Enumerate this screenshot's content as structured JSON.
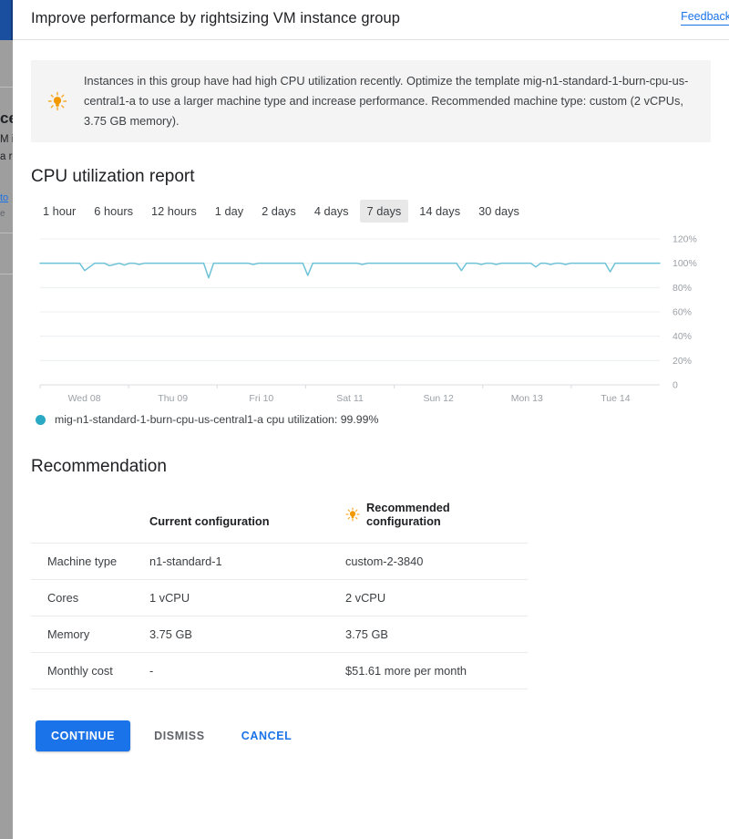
{
  "background": {
    "title_fragment": "ce",
    "line1_fragment": "M i",
    "line2_fragment": "a r",
    "link_fragment": "to",
    "line3_fragment": "e"
  },
  "dialog": {
    "title": "Improve performance by rightsizing VM instance group",
    "feedback_label": "Feedback"
  },
  "banner": {
    "icon": "lightbulb-icon",
    "text": "Instances in this group have had high CPU utilization recently. Optimize the template mig-n1-standard-1-burn-cpu-us-central1-a to use a larger machine type and increase performance. Recommended machine type: custom (2 vCPUs, 3.75 GB memory)."
  },
  "cpu_section": {
    "heading": "CPU utilization report",
    "ranges": [
      {
        "label": "1 hour",
        "selected": false
      },
      {
        "label": "6 hours",
        "selected": false
      },
      {
        "label": "12 hours",
        "selected": false
      },
      {
        "label": "1 day",
        "selected": false
      },
      {
        "label": "2 days",
        "selected": false
      },
      {
        "label": "4 days",
        "selected": false
      },
      {
        "label": "7 days",
        "selected": true
      },
      {
        "label": "14 days",
        "selected": false
      },
      {
        "label": "30 days",
        "selected": false
      }
    ],
    "legend": {
      "color": "#2aa8c4",
      "label": "mig-n1-standard-1-burn-cpu-us-central1-a cpu utilization: 99.99%"
    }
  },
  "chart_data": {
    "type": "line",
    "title": "CPU utilization report",
    "xlabel": "",
    "ylabel": "",
    "ylim": [
      0,
      120
    ],
    "yticks": [
      0,
      20,
      40,
      60,
      80,
      100,
      120
    ],
    "ytick_labels": [
      "0",
      "20%",
      "40%",
      "60%",
      "80%",
      "100%",
      "120%"
    ],
    "grid": true,
    "legend_position": "below",
    "categories": [
      "Wed 08",
      "Thu 09",
      "Fri 10",
      "Sat 11",
      "Sun 12",
      "Mon 13",
      "Tue 14"
    ],
    "line_color": "#6dc2d6",
    "series": [
      {
        "name": "mig-n1-standard-1-burn-cpu-us-central1-a cpu utilization",
        "current_value": 99.99,
        "values": [
          100,
          100,
          100,
          100,
          100,
          100,
          100,
          100,
          99.9,
          94,
          97,
          100,
          100,
          100,
          98,
          99,
          100,
          98.5,
          100,
          100,
          99,
          100,
          100,
          100,
          100,
          100,
          100,
          100,
          100,
          100,
          100,
          100,
          100,
          100,
          88,
          100,
          100,
          100,
          100,
          100,
          100,
          100,
          100,
          99,
          100,
          100,
          100,
          100,
          100,
          100,
          100,
          100,
          100,
          100,
          90,
          100,
          100,
          100,
          100,
          100,
          100,
          100,
          100,
          100,
          100,
          99,
          100,
          100,
          100,
          100,
          100,
          100,
          100,
          100,
          100,
          100,
          100,
          100,
          100,
          100,
          100,
          100,
          100,
          100,
          100,
          94,
          100,
          100,
          100,
          99,
          100,
          100,
          99,
          100,
          100,
          100,
          100,
          100,
          100,
          100,
          97,
          100,
          100,
          99,
          100,
          100,
          99,
          100,
          100,
          100,
          100,
          100,
          100,
          100,
          100,
          93,
          100,
          100,
          100,
          100,
          100,
          100,
          100,
          100,
          100,
          100
        ]
      }
    ]
  },
  "recommendation": {
    "heading": "Recommendation",
    "columns": [
      "",
      "Current configuration",
      "Recommended configuration"
    ],
    "recommended_icon": "lightbulb-icon",
    "rows": [
      {
        "label": "Machine type",
        "current": "n1-standard-1",
        "recommended": "custom-2-3840"
      },
      {
        "label": "Cores",
        "current": "1 vCPU",
        "recommended": "2 vCPU"
      },
      {
        "label": "Memory",
        "current": "3.75 GB",
        "recommended": "3.75 GB"
      },
      {
        "label": "Monthly cost",
        "current": "-",
        "recommended": "$51.61 more per month"
      }
    ]
  },
  "actions": {
    "continue_label": "CONTINUE",
    "dismiss_label": "DISMISS",
    "cancel_label": "CANCEL"
  },
  "colors": {
    "primary": "#1a73e8",
    "accent_orange": "#f9a825",
    "chart_line": "#6dc2d6",
    "legend_dot": "#2aa8c4"
  }
}
